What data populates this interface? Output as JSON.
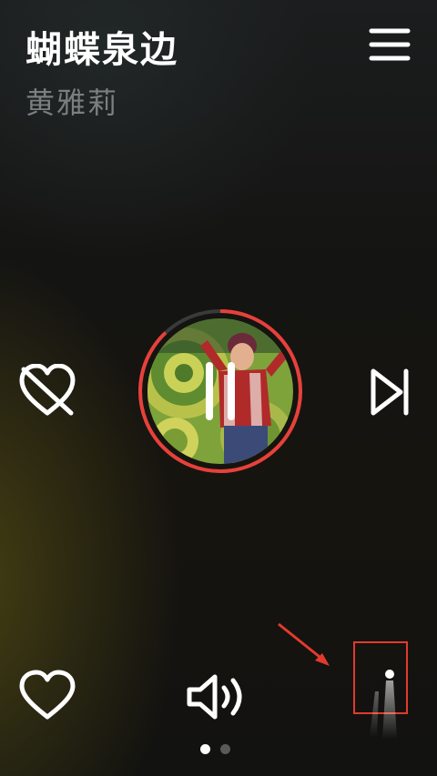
{
  "song": {
    "title": "蝴蝶泉边",
    "artist": "黄雅莉"
  },
  "player": {
    "state": "playing",
    "progress_fraction": 0.12
  },
  "controls": {
    "menu_icon": "hamburger-menu-icon",
    "dislike_icon": "heart-crossed-icon",
    "next_icon": "skip-next-icon",
    "pause_icon": "pause-icon",
    "favorite_icon": "heart-outline-icon",
    "volume_icon": "volume-icon",
    "more_icon": "more-dot-icon"
  },
  "pager": {
    "pages": 2,
    "current": 1
  },
  "colors": {
    "progress_ring": "#e8403a",
    "annotation": "#e33a2c",
    "title": "#ffffff",
    "artist": "#7c7f80"
  }
}
